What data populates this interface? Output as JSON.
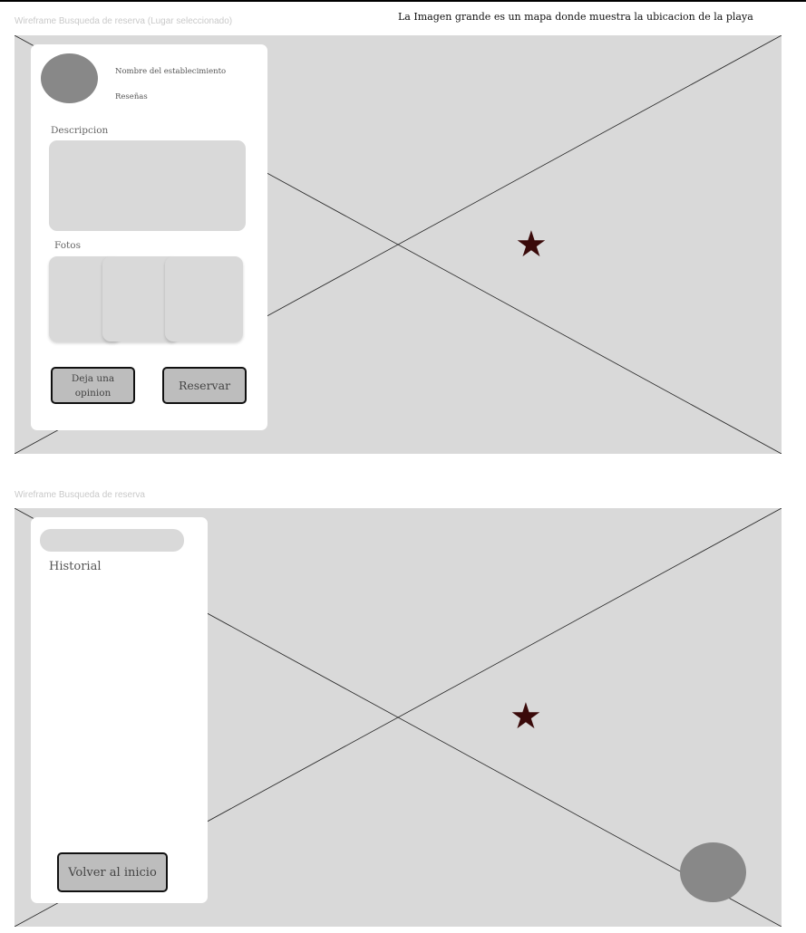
{
  "note": "La Imagen grande es un mapa donde muestra la ubicacion de la playa",
  "frame1": {
    "label": "Wireframe Busqueda de reserva (Lugar seleccionado)",
    "establishment_name": "Nombre del establecimiento",
    "reviews": "Reseñas",
    "description_label": "Descripcion",
    "photos_label": "Fotos",
    "opinion_button": "Deja una opinion",
    "reserve_button": "Reservar",
    "map_marker_icon": "star-icon"
  },
  "frame2": {
    "label": "Wireframe Busqueda de reserva",
    "history_label": "Historial",
    "back_button": "Volver al inicio",
    "map_marker_icon": "star-icon"
  },
  "colors": {
    "map_fill": "#d9d9d9",
    "avatar": "#888888",
    "button_fill": "#bdbdbd",
    "star": "#3a0a0a"
  }
}
